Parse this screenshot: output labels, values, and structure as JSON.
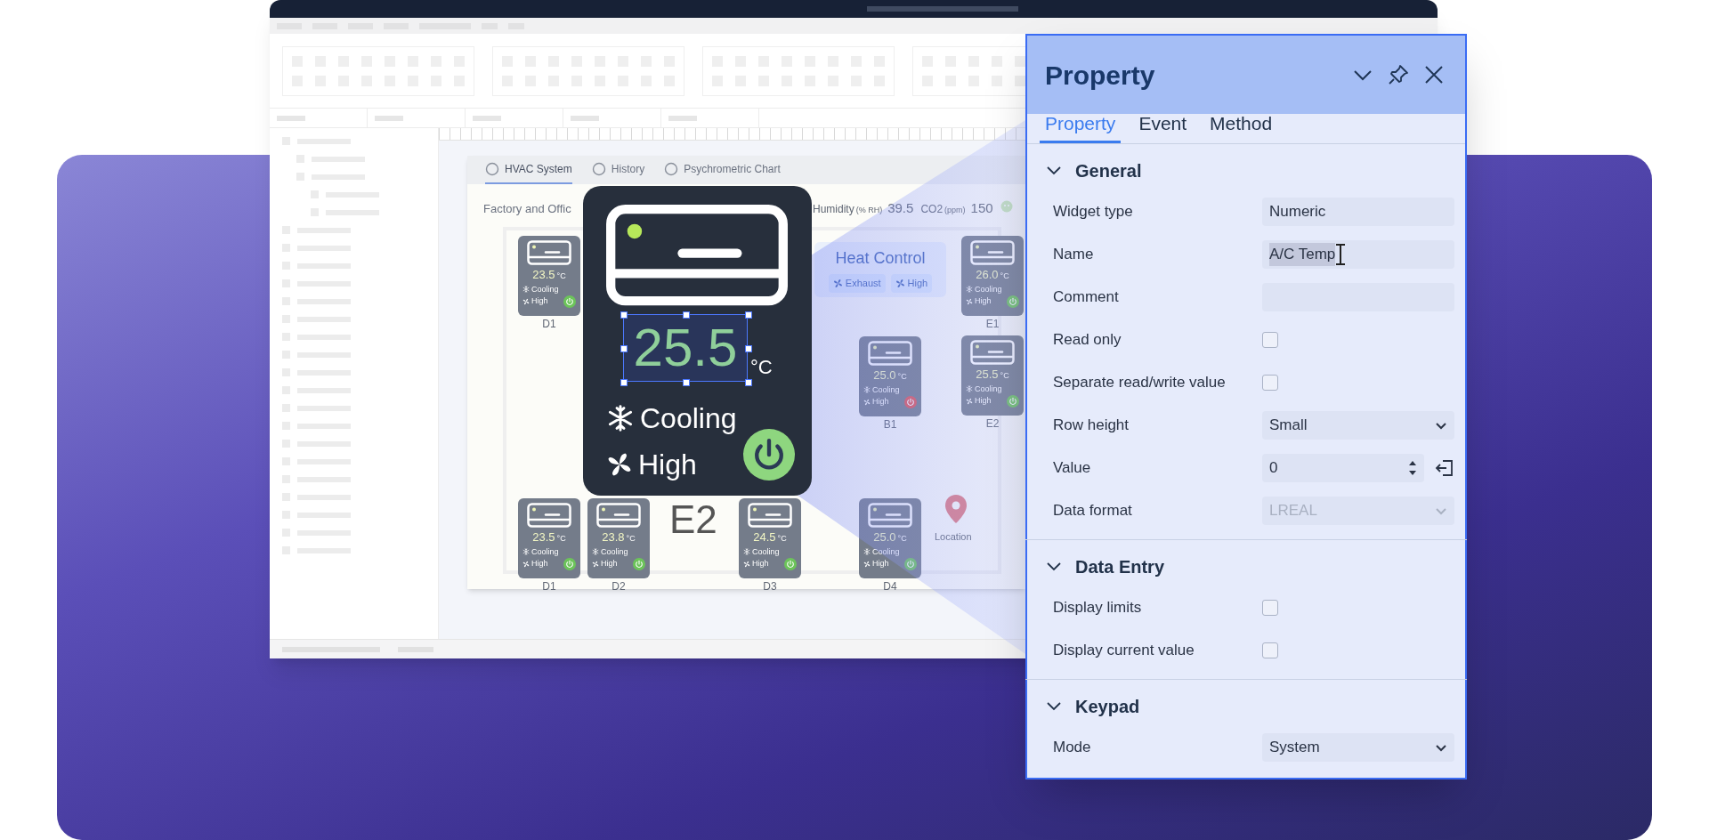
{
  "app": {
    "canvas_tabs": [
      {
        "label": "HVAC System",
        "selected": true
      },
      {
        "label": "History",
        "selected": false
      },
      {
        "label": "Psychrometric Chart",
        "selected": false
      }
    ],
    "page_title": "Factory and Offic",
    "readings": [
      {
        "label": "Humidity",
        "unit": "(% RH)",
        "value": "39.5"
      },
      {
        "label": "CO2",
        "unit": "(ppm)",
        "value": "150"
      }
    ],
    "heat_control": {
      "title": "Heat Control",
      "chips": [
        "Exhaust",
        "High"
      ]
    },
    "units": [
      {
        "name": "D1",
        "temperature": "23.5",
        "unit": "°C",
        "mode": "Cooling",
        "fan": "High",
        "on": true
      },
      {
        "name": "E1",
        "temperature": "26.0",
        "unit": "°C",
        "mode": "Cooling",
        "fan": "High",
        "on": true
      },
      {
        "name": "B1",
        "temperature": "25.0",
        "unit": "°C",
        "mode": "Cooling",
        "fan": "High",
        "on": false
      },
      {
        "name": "E2",
        "temperature": "25.5",
        "unit": "°C",
        "mode": "Cooling",
        "fan": "High",
        "on": true
      },
      {
        "name": "D1",
        "temperature": "23.5",
        "unit": "°C",
        "mode": "Cooling",
        "fan": "High",
        "on": true
      },
      {
        "name": "D2",
        "temperature": "23.8",
        "unit": "°C",
        "mode": "Cooling",
        "fan": "High",
        "on": true
      },
      {
        "name": "D3",
        "temperature": "24.5",
        "unit": "°C",
        "mode": "Cooling",
        "fan": "High",
        "on": true
      },
      {
        "name": "D4",
        "temperature": "25.0",
        "unit": "°C",
        "mode": "Cooling",
        "fan": "High",
        "on": true
      }
    ],
    "location": "Location"
  },
  "widget": {
    "temperature": "25.5",
    "unit": "°C",
    "mode": "Cooling",
    "fan": "High",
    "on": true,
    "label": "E2"
  },
  "panel": {
    "title": "Property",
    "tabs": [
      {
        "label": "Property",
        "selected": true
      },
      {
        "label": "Event",
        "selected": false
      },
      {
        "label": "Method",
        "selected": false
      }
    ],
    "sections": [
      {
        "title": "General",
        "expanded": true,
        "rows": [
          {
            "kind": "text",
            "label": "Widget type",
            "value": "Numeric",
            "highlighted": false
          },
          {
            "kind": "text",
            "label": "Name",
            "value": "A/C Temp",
            "highlighted": true
          },
          {
            "kind": "text",
            "label": "Comment",
            "highlighted": false
          },
          {
            "kind": "checkbox",
            "label": "Read only",
            "checked": false
          },
          {
            "kind": "checkbox",
            "label": "Separate read/write value",
            "checked": false
          },
          {
            "kind": "select",
            "label": "Row height",
            "value": "Small",
            "disabled": false
          },
          {
            "kind": "spin",
            "label": "Value",
            "value": "0"
          },
          {
            "kind": "select",
            "label": "Data format",
            "value": "LREAL",
            "disabled": true
          }
        ]
      },
      {
        "title": "Data Entry",
        "expanded": true,
        "rows": [
          {
            "kind": "checkbox",
            "label": "Display limits",
            "checked": false
          },
          {
            "kind": "checkbox",
            "label": "Display current value",
            "checked": false
          }
        ]
      },
      {
        "title": "Keypad",
        "expanded": true,
        "rows": [
          {
            "kind": "select",
            "label": "Mode",
            "value": "System",
            "disabled": false
          }
        ]
      }
    ]
  }
}
